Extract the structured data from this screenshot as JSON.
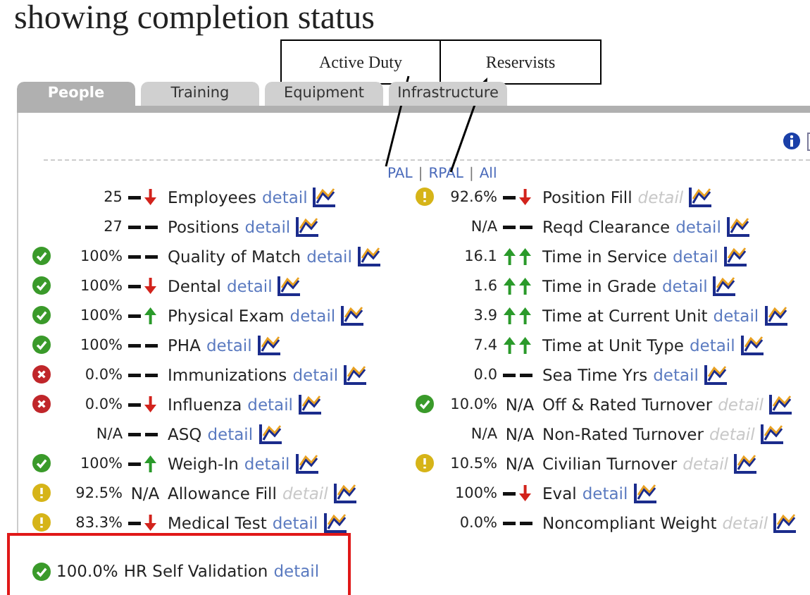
{
  "document_heading": "showing completion status",
  "callouts": [
    "Active Duty",
    "Reservists"
  ],
  "tabs": [
    {
      "label": "People",
      "selected": true
    },
    {
      "label": "Training",
      "selected": false
    },
    {
      "label": "Equipment",
      "selected": false
    },
    {
      "label": "Infrastructure",
      "selected": false
    }
  ],
  "filter_links": [
    "PAL",
    "RPAL",
    "All"
  ],
  "filter_separators": [
    "|",
    "|"
  ],
  "left_metrics": [
    {
      "value": "25",
      "trend": {
        "kind": "down"
      },
      "label": "Employees",
      "detail": "detail",
      "detail_enabled": true
    },
    {
      "value": "27",
      "trend": {
        "kind": "flat"
      },
      "label": "Positions",
      "detail": "detail",
      "detail_enabled": true
    },
    {
      "status": {
        "kind": "ok"
      },
      "value": "100%",
      "trend": {
        "kind": "flat"
      },
      "label": "Quality of Match",
      "detail": "detail",
      "detail_enabled": true
    },
    {
      "status": {
        "kind": "ok"
      },
      "value": "100%",
      "trend": {
        "kind": "down"
      },
      "label": "Dental",
      "detail": "detail",
      "detail_enabled": true
    },
    {
      "status": {
        "kind": "ok"
      },
      "value": "100%",
      "trend": {
        "kind": "up"
      },
      "label": "Physical Exam",
      "detail": "detail",
      "detail_enabled": true
    },
    {
      "status": {
        "kind": "ok"
      },
      "value": "100%",
      "trend": {
        "kind": "flat"
      },
      "label": "PHA",
      "detail": "detail",
      "detail_enabled": true
    },
    {
      "status": {
        "kind": "error"
      },
      "value": "0.0%",
      "trend": {
        "kind": "flat"
      },
      "label": "Immunizations",
      "detail": "detail",
      "detail_enabled": true
    },
    {
      "status": {
        "kind": "error"
      },
      "value": "0.0%",
      "trend": {
        "kind": "down"
      },
      "label": "Influenza",
      "detail": "detail",
      "detail_enabled": true
    },
    {
      "value": "N/A",
      "trend": {
        "kind": "flat"
      },
      "label": "ASQ",
      "detail": "detail",
      "detail_enabled": true
    },
    {
      "status": {
        "kind": "ok"
      },
      "value": "100%",
      "trend": {
        "kind": "up"
      },
      "label": "Weigh-In",
      "detail": "detail",
      "detail_enabled": true
    },
    {
      "status": {
        "kind": "warning"
      },
      "value": "92.5%",
      "trend": {
        "kind": "text",
        "text": "N/A"
      },
      "label": "Allowance Fill",
      "detail": "detail",
      "detail_enabled": false
    },
    {
      "status": {
        "kind": "warning"
      },
      "value": "83.3%",
      "trend": {
        "kind": "down"
      },
      "label": "Medical Test",
      "detail": "detail",
      "detail_enabled": true
    }
  ],
  "right_metrics": [
    {
      "status": {
        "kind": "warning"
      },
      "value": "92.6%",
      "trend": {
        "kind": "down"
      },
      "label": "Position Fill",
      "detail": "detail",
      "detail_enabled": false
    },
    {
      "value": "N/A",
      "trend": {
        "kind": "flat"
      },
      "label": "Reqd Clearance",
      "detail": "detail",
      "detail_enabled": true
    },
    {
      "value": "16.1",
      "trend": {
        "kind": "upup"
      },
      "label": "Time in Service",
      "detail": "detail",
      "detail_enabled": true
    },
    {
      "value": "1.6",
      "trend": {
        "kind": "upup"
      },
      "label": "Time in Grade",
      "detail": "detail",
      "detail_enabled": true
    },
    {
      "value": "3.9",
      "trend": {
        "kind": "upup"
      },
      "label": "Time at Current Unit",
      "detail": "detail",
      "detail_enabled": true
    },
    {
      "value": "7.4",
      "trend": {
        "kind": "upup"
      },
      "label": "Time at Unit Type",
      "detail": "detail",
      "detail_enabled": true
    },
    {
      "value": "0.0",
      "trend": {
        "kind": "flat"
      },
      "label": "Sea Time Yrs",
      "detail": "detail",
      "detail_enabled": true
    },
    {
      "status": {
        "kind": "ok"
      },
      "value": "10.0%",
      "trend": {
        "kind": "text",
        "text": "N/A"
      },
      "label": "Off & Rated Turnover",
      "detail": "detail",
      "detail_enabled": false
    },
    {
      "value": "N/A",
      "trend": {
        "kind": "text",
        "text": "N/A"
      },
      "label": "Non-Rated Turnover",
      "detail": "detail",
      "detail_enabled": false
    },
    {
      "status": {
        "kind": "warning"
      },
      "value": "10.5%",
      "trend": {
        "kind": "text",
        "text": "N/A"
      },
      "label": "Civilian Turnover",
      "detail": "detail",
      "detail_enabled": false
    },
    {
      "value": "100%",
      "trend": {
        "kind": "down"
      },
      "label": "Eval",
      "detail": "detail",
      "detail_enabled": true
    },
    {
      "value": "0.0%",
      "trend": {
        "kind": "flat"
      },
      "label": "Noncompliant Weight",
      "detail": "detail",
      "detail_enabled": false
    }
  ],
  "validation": {
    "status": {
      "kind": "ok"
    },
    "value": "100.0%",
    "label": "HR Self Validation",
    "detail": "detail",
    "detail_enabled": true
  }
}
